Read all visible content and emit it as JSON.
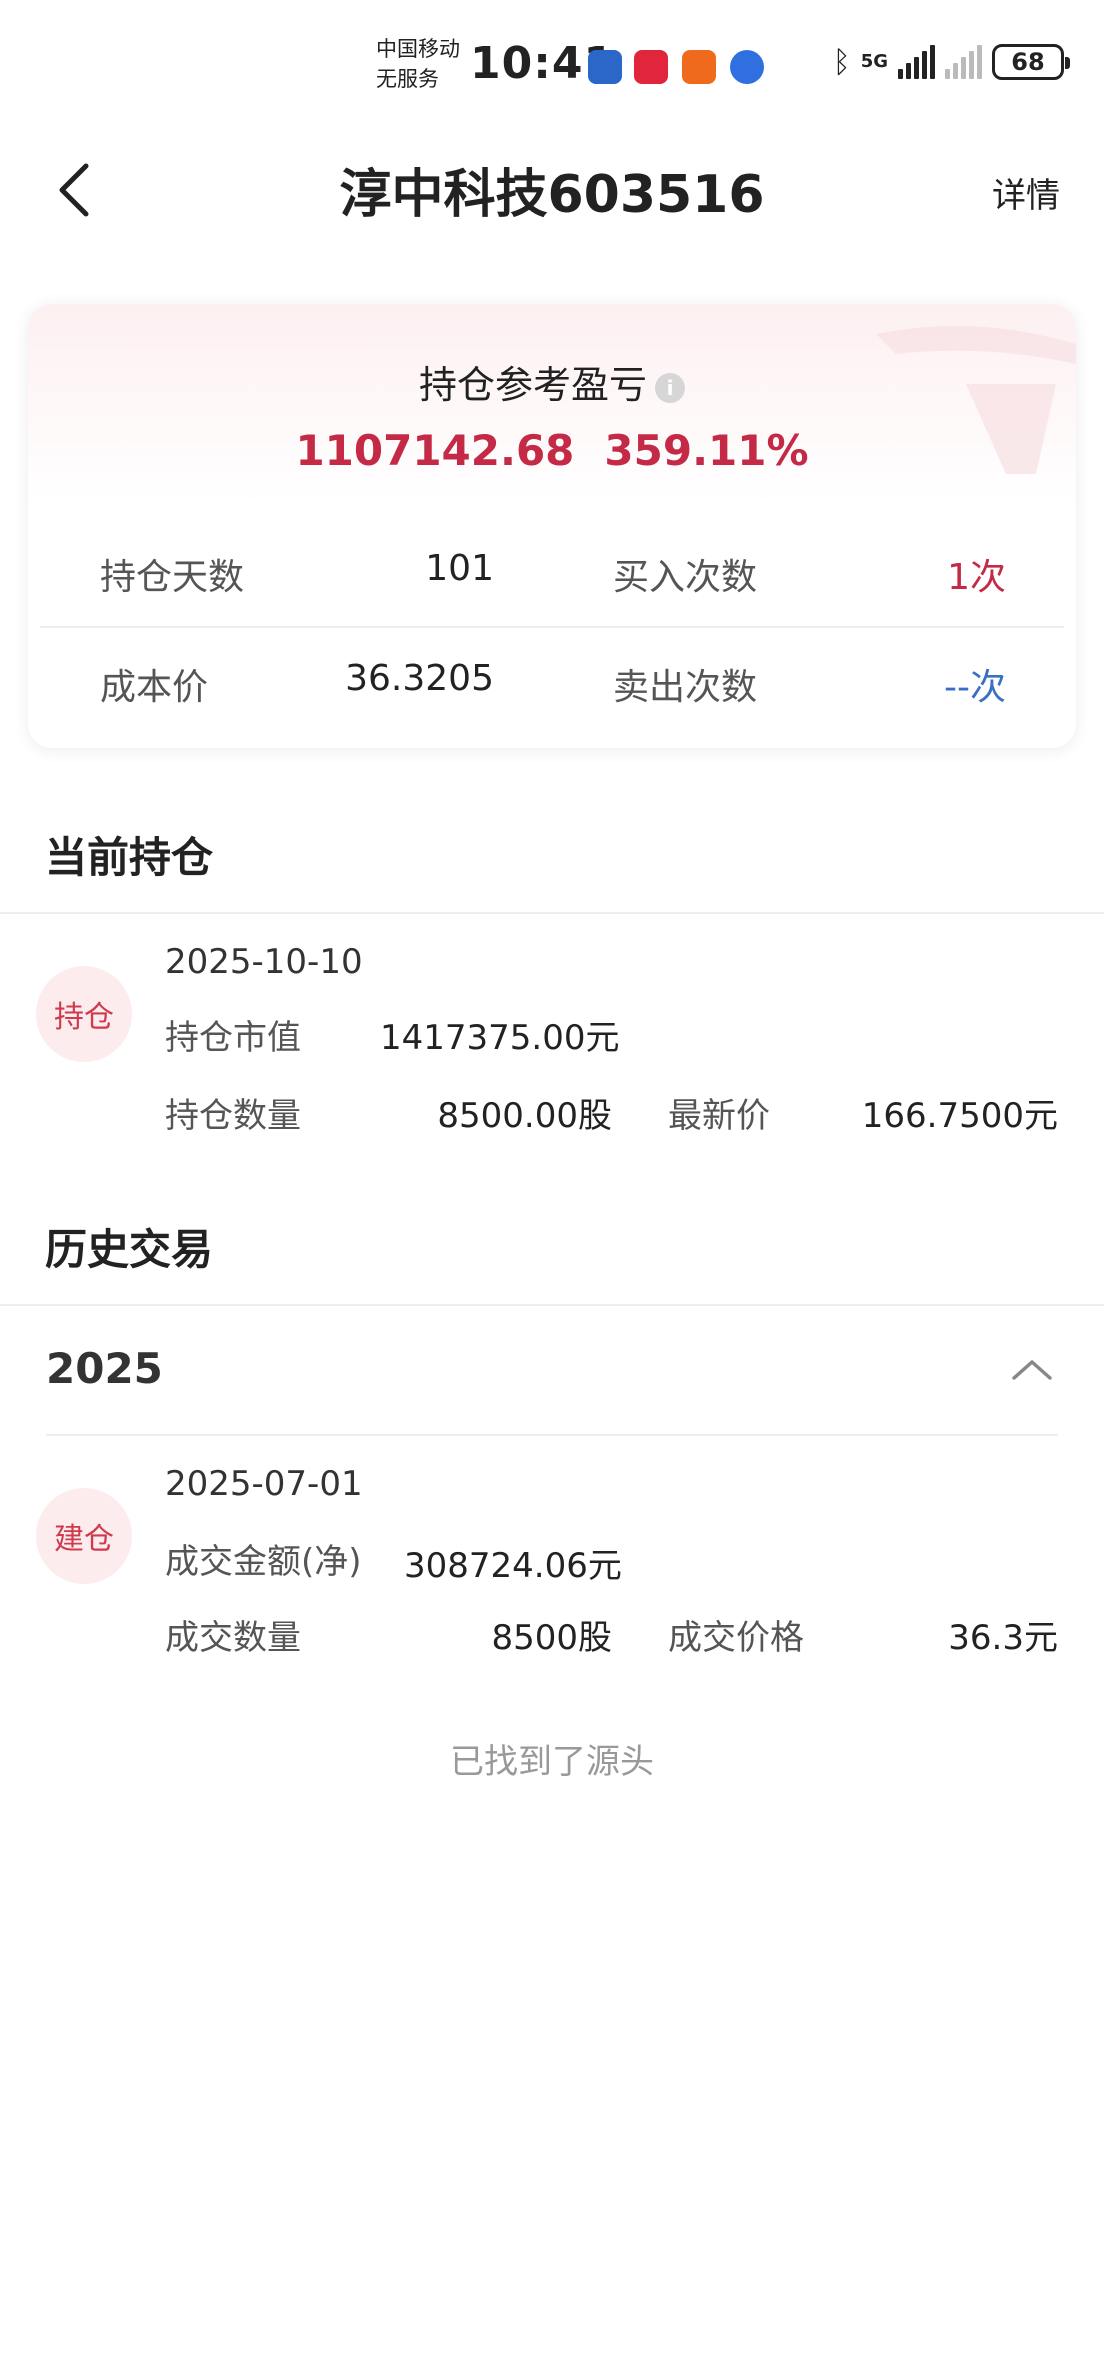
{
  "status_bar": {
    "carrier_line1": "中国移动",
    "carrier_line2": "无服务",
    "time": "10:41",
    "network": "5G",
    "battery": "68",
    "app_icons": [
      "message-app-icon",
      "health-app-icon",
      "paper-plane-app-icon",
      "browser-app-icon"
    ],
    "app_icon_colors": [
      "#2a67c6",
      "#e0253c",
      "#f06a1e",
      "#2f6fe0"
    ]
  },
  "nav": {
    "title": "淳中科技603516",
    "detail_label": "详情"
  },
  "summary": {
    "label": "持仓参考盈亏",
    "info_glyph": "i",
    "profit_amount": "1107142.68",
    "profit_percent": "359.11%",
    "rows": [
      {
        "k1": "持仓天数",
        "v1": "101",
        "k2": "买入次数",
        "v2": "1次"
      },
      {
        "k1": "成本价",
        "v1": "36.3205",
        "k2": "卖出次数",
        "v2": "--次"
      }
    ],
    "colors": {
      "profit": "#c42a46",
      "buy_count": "#c42a46",
      "sell_count": "#3a6fc4"
    }
  },
  "current": {
    "section_title": "当前持仓",
    "badge": "持仓",
    "date": "2025-10-10",
    "market_value_label": "持仓市值",
    "market_value": "1417375.00元",
    "quantity_label": "持仓数量",
    "quantity": "8500.00股",
    "latest_price_label": "最新价",
    "latest_price": "166.7500元"
  },
  "history": {
    "section_title": "历史交易",
    "year": "2025",
    "record": {
      "badge": "建仓",
      "date": "2025-07-01",
      "amount_label": "成交金额(净)",
      "amount": "308724.06元",
      "quantity_label": "成交数量",
      "quantity": "8500股",
      "price_label": "成交价格",
      "price": "36.3元"
    },
    "end_text": "已找到了源头"
  }
}
